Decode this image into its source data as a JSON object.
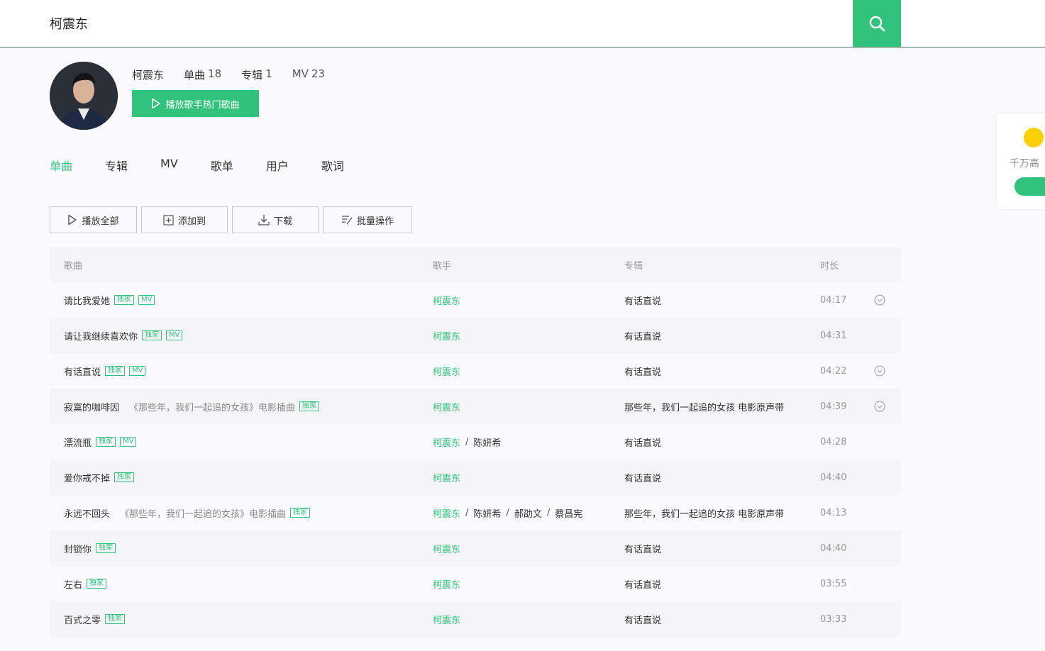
{
  "search": {
    "value": "柯震东",
    "icon": "search-icon"
  },
  "artist": {
    "name": "柯震东",
    "singles_label": "单曲",
    "singles_count": "18",
    "albums_label": "专辑",
    "albums_count": "1",
    "mv_label": "MV",
    "mv_count": "23",
    "play_hot_label": "播放歌手热门歌曲"
  },
  "tabs": [
    {
      "label": "单曲",
      "active": true
    },
    {
      "label": "专辑"
    },
    {
      "label": "MV"
    },
    {
      "label": "歌单"
    },
    {
      "label": "用户"
    },
    {
      "label": "歌词"
    }
  ],
  "toolbar": {
    "play_all": "播放全部",
    "add_to": "添加到",
    "download": "下载",
    "batch": "批量操作"
  },
  "table": {
    "headers": {
      "song": "歌曲",
      "singer": "歌手",
      "album": "专辑",
      "duration": "时长"
    },
    "tag_exclusive": "独家",
    "tag_mv": "MV",
    "rows": [
      {
        "title": "请比我爱她",
        "sub": "",
        "mv": true,
        "singers": [
          "柯震东"
        ],
        "album": "有话直说",
        "duration": "04:17",
        "more": true
      },
      {
        "title": "请让我继续喜欢你",
        "sub": "",
        "mv": true,
        "singers": [
          "柯震东"
        ],
        "album": "有话直说",
        "duration": "04:31",
        "more": false
      },
      {
        "title": "有话直说",
        "sub": "",
        "mv": true,
        "singers": [
          "柯震东"
        ],
        "album": "有话直说",
        "duration": "04:22",
        "more": true
      },
      {
        "title": "寂寞的咖啡因",
        "sub": "《那些年，我们一起追的女孩》电影插曲",
        "mv": false,
        "singers": [
          "柯震东"
        ],
        "album": "那些年，我们一起追的女孩 电影原声带",
        "duration": "04:39",
        "more": true
      },
      {
        "title": "漂流瓶",
        "sub": "",
        "mv": true,
        "singers": [
          "柯震东",
          "陈妍希"
        ],
        "album": "有话直说",
        "duration": "04:28",
        "more": false
      },
      {
        "title": "爱你戒不掉",
        "sub": "",
        "mv": false,
        "singers": [
          "柯震东"
        ],
        "album": "有话直说",
        "duration": "04:40",
        "more": false
      },
      {
        "title": "永远不回头",
        "sub": "《那些年，我们一起追的女孩》电影插曲",
        "mv": false,
        "singers": [
          "柯震东",
          "陈妍希",
          "郝劭文",
          "蔡昌宪"
        ],
        "album": "那些年，我们一起追的女孩 电影原声带",
        "duration": "04:13",
        "more": false
      },
      {
        "title": "封锁你",
        "sub": "",
        "mv": false,
        "singers": [
          "柯震东"
        ],
        "album": "有话直说",
        "duration": "04:40",
        "more": false
      },
      {
        "title": "左右",
        "sub": "",
        "mv": false,
        "singers": [
          "柯震东"
        ],
        "album": "有话直说",
        "duration": "03:55",
        "more": false
      },
      {
        "title": "百式之零",
        "sub": "",
        "mv": false,
        "singers": [
          "柯震东"
        ],
        "album": "有话直说",
        "duration": "03:33",
        "more": false
      }
    ]
  },
  "side_ad": {
    "text": "千万高"
  },
  "colors": {
    "accent": "#31c27c",
    "muted": "#999999",
    "row_alt": "#f5f5f7"
  }
}
